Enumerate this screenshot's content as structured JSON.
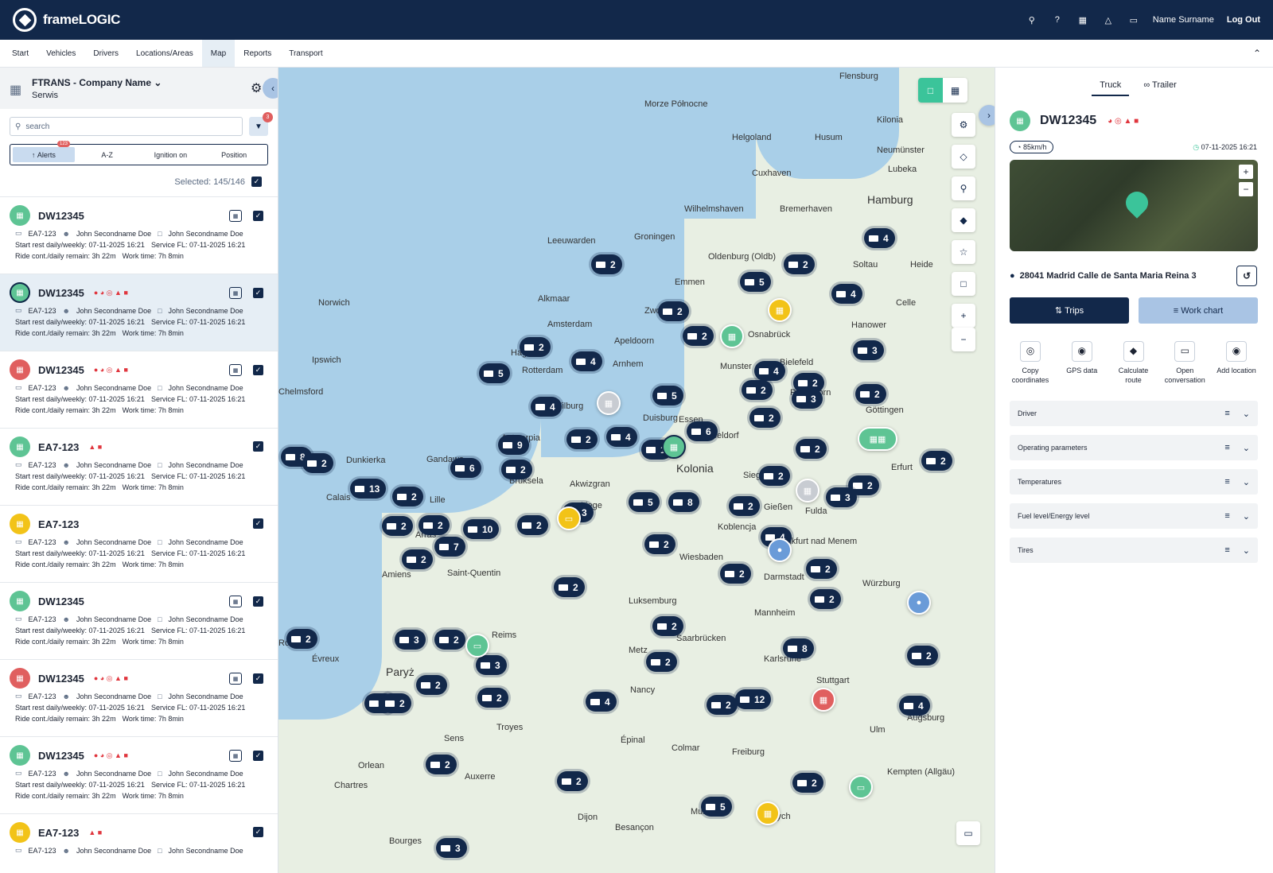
{
  "app": {
    "brand": "frameLOGIC",
    "user": "Name Surname",
    "logout": "Log Out"
  },
  "nav": [
    "Start",
    "Vehicles",
    "Drivers",
    "Locations/Areas",
    "Map",
    "Reports",
    "Transport"
  ],
  "active_tab": "Map",
  "company": {
    "name": "FTRANS - Company Name",
    "sub": "Serwis"
  },
  "search": {
    "placeholder": "search",
    "filter_count": "3"
  },
  "sort": {
    "alerts": "Alerts",
    "alerts_badge": "123",
    "az": "A-Z",
    "ign": "Ignition on",
    "pos": "Position"
  },
  "selected": "Selected: 145/146",
  "rows": [
    {
      "name": "DW12345",
      "color": "#5ec494",
      "trailer": "EA7-123",
      "driver1": "John Secondname Doe",
      "driver2": "John Secondname Doe",
      "rest": "Start rest daily/weekly: 07-11-2025 16:21",
      "service": "Service FL: 07-11-2025 16:21",
      "ride": "Ride cont./daily remain: 3h 22m",
      "work": "Work time: 7h 8min",
      "alerts": false,
      "qr": true
    },
    {
      "name": "DW12345",
      "color": "#5ec494",
      "trailer": "EA7-123",
      "driver1": "John Secondname Doe",
      "driver2": "John Secondname Doe",
      "rest": "Start rest daily/weekly: 07-11-2025 16:21",
      "service": "Service FL: 07-11-2025 16:21",
      "ride": "Ride cont./daily remain: 3h 22m",
      "work": "Work time: 7h 8min",
      "alerts": true,
      "qr": true
    },
    {
      "name": "DW12345",
      "color": "#e05f5f",
      "trailer": "EA7-123",
      "driver1": "John Secondname Doe",
      "driver2": "John Secondname Doe",
      "rest": "Start rest daily/weekly: 07-11-2025 16:21",
      "service": "Service FL: 07-11-2025 16:21",
      "ride": "Ride cont./daily remain: 3h 22m",
      "work": "Work time: 7h 8min",
      "alerts": true,
      "qr": true
    },
    {
      "name": "EA7-123",
      "color": "#5ec494",
      "trailer": "EA7-123",
      "driver1": "John Secondname Doe",
      "driver2": "John Secondname Doe",
      "rest": "Start rest daily/weekly: 07-11-2025 16:21",
      "service": "Service FL: 07-11-2025 16:21",
      "ride": "Ride cont./daily remain: 3h 22m",
      "work": "Work time: 7h 8min",
      "alerts": "short",
      "qr": false
    },
    {
      "name": "EA7-123",
      "color": "#f2c318",
      "trailer": "EA7-123",
      "driver1": "John Secondname Doe",
      "driver2": "John Secondname Doe",
      "rest": "Start rest daily/weekly: 07-11-2025 16:21",
      "service": "Service FL: 07-11-2025 16:21",
      "ride": "Ride cont./daily remain: 3h 22m",
      "work": "Work time: 7h 8min",
      "alerts": false,
      "qr": false
    },
    {
      "name": "DW12345",
      "color": "#5ec494",
      "trailer": "EA7-123",
      "driver1": "John Secondname Doe",
      "driver2": "John Secondname Doe",
      "rest": "Start rest daily/weekly: 07-11-2025 16:21",
      "service": "Service FL: 07-11-2025 16:21",
      "ride": "Ride cont./daily remain: 3h 22m",
      "work": "Work time: 7h 8min",
      "alerts": false,
      "qr": true
    },
    {
      "name": "DW12345",
      "color": "#e05f5f",
      "trailer": "EA7-123",
      "driver1": "John Secondname Doe",
      "driver2": "John Secondname Doe",
      "rest": "Start rest daily/weekly: 07-11-2025 16:21",
      "service": "Service FL: 07-11-2025 16:21",
      "ride": "Ride cont./daily remain: 3h 22m",
      "work": "Work time: 7h 8min",
      "alerts": true,
      "qr": true
    },
    {
      "name": "DW12345",
      "color": "#5ec494",
      "trailer": "EA7-123",
      "driver1": "John Secondname Doe",
      "driver2": "John Secondname Doe",
      "rest": "Start rest daily/weekly: 07-11-2025 16:21",
      "service": "Service FL: 07-11-2025 16:21",
      "ride": "Ride cont./daily remain: 3h 22m",
      "work": "Work time: 7h 8min",
      "alerts": true,
      "qr": true
    },
    {
      "name": "EA7-123",
      "color": "#f2c318",
      "trailer": "EA7-123",
      "driver1": "John Secondname Doe",
      "driver2": "John Secondname Doe",
      "rest": "",
      "service": "",
      "ride": "",
      "work": "",
      "alerts": "short",
      "qr": false
    }
  ],
  "map": {
    "cities": [
      "Flensburg",
      "Kilonia",
      "Lubeka",
      "Hamburg",
      "Bremerhaven",
      "Wilhelmshaven",
      "Groningen",
      "Leeuwarden",
      "Oldenburg (Oldb)",
      "Emmen",
      "Alkmaar",
      "Zwolle",
      "Amsterdam",
      "Apeldoorn",
      "Osnabrück",
      "Hanower",
      "Haga",
      "Rotterdam",
      "Arnhem",
      "Munster",
      "Bielefeld",
      "Paderborn",
      "Göttingen",
      "Tilburg",
      "Duisburg",
      "Essen",
      "Düsseldorf",
      "Kolonia",
      "Siegen",
      "Erfurt",
      "Antwerpia",
      "Gandawa",
      "Bruksela",
      "Lille",
      "Akwizgran",
      "Liege",
      "Gießen",
      "Fulda",
      "Koblencja",
      "Frankfurt nad Menem",
      "Arras",
      "Amiens",
      "Wiesbaden",
      "Darmstadt",
      "Würzburg",
      "Luksemburg",
      "Mannheim",
      "Reims",
      "Saarbrücken",
      "Metz",
      "Karlsruhe",
      "Paryż",
      "Nancy",
      "Stuttgart",
      "Troyes",
      "Freiburg",
      "Orlean",
      "Dijon",
      "Mulhouse",
      "Zurych",
      "Augsburg",
      "Ipswich",
      "Norwich",
      "Chelmsford",
      "Dunkierka",
      "Calais",
      "Rouen",
      "Ulm",
      "Kempten (Allgäu)",
      "Besançon",
      "Bourges",
      "Chartres",
      "Évreux",
      "Sens",
      "Auxerre",
      "Colmar",
      "Épinal",
      "Saint-Quentin",
      "Celle",
      "Cuxhaven",
      "Soltau",
      "Heide",
      "Husum",
      "Neumünster",
      "Helgoland",
      "Morze Północne"
    ],
    "pins": [
      "2",
      "4",
      "5",
      "2",
      "5",
      "2",
      "4",
      "2",
      "2",
      "2",
      "4",
      "4",
      "2",
      "3",
      "2",
      "5",
      "3",
      "2",
      "4",
      "2",
      "9",
      "4",
      "2",
      "6",
      "2",
      "1",
      "6",
      "2",
      "2",
      "8",
      "5",
      "13",
      "2",
      "2",
      "3",
      "2",
      "8",
      "2",
      "3",
      "2",
      "2",
      "7",
      "10",
      "2",
      "2",
      "4",
      "2",
      "2",
      "2",
      "2",
      "2",
      "8",
      "2",
      "2",
      "3",
      "2",
      "3",
      "2",
      "4",
      "2",
      "2",
      "2",
      "4",
      "2",
      "12",
      "5",
      "2",
      "4",
      "2",
      "2",
      "2",
      "3"
    ]
  },
  "detail": {
    "tab_truck": "Truck",
    "tab_trailer": "Trailer",
    "vehicle": "DW12345",
    "speed": "85km/h",
    "time": "07-11-2025 16:21",
    "address": "28041 Madrid Calle de Santa Maria Reina 3",
    "trips": "Trips",
    "workchart": "Work chart",
    "actions": [
      {
        "label": "Copy coordinates"
      },
      {
        "label": "GPS data"
      },
      {
        "label": "Calculate route"
      },
      {
        "label": "Open conversation"
      },
      {
        "label": "Add location"
      }
    ],
    "sections": [
      "Driver",
      "Operating parameters",
      "Temperatures",
      "Fuel level/Energy level",
      "Tires"
    ]
  }
}
